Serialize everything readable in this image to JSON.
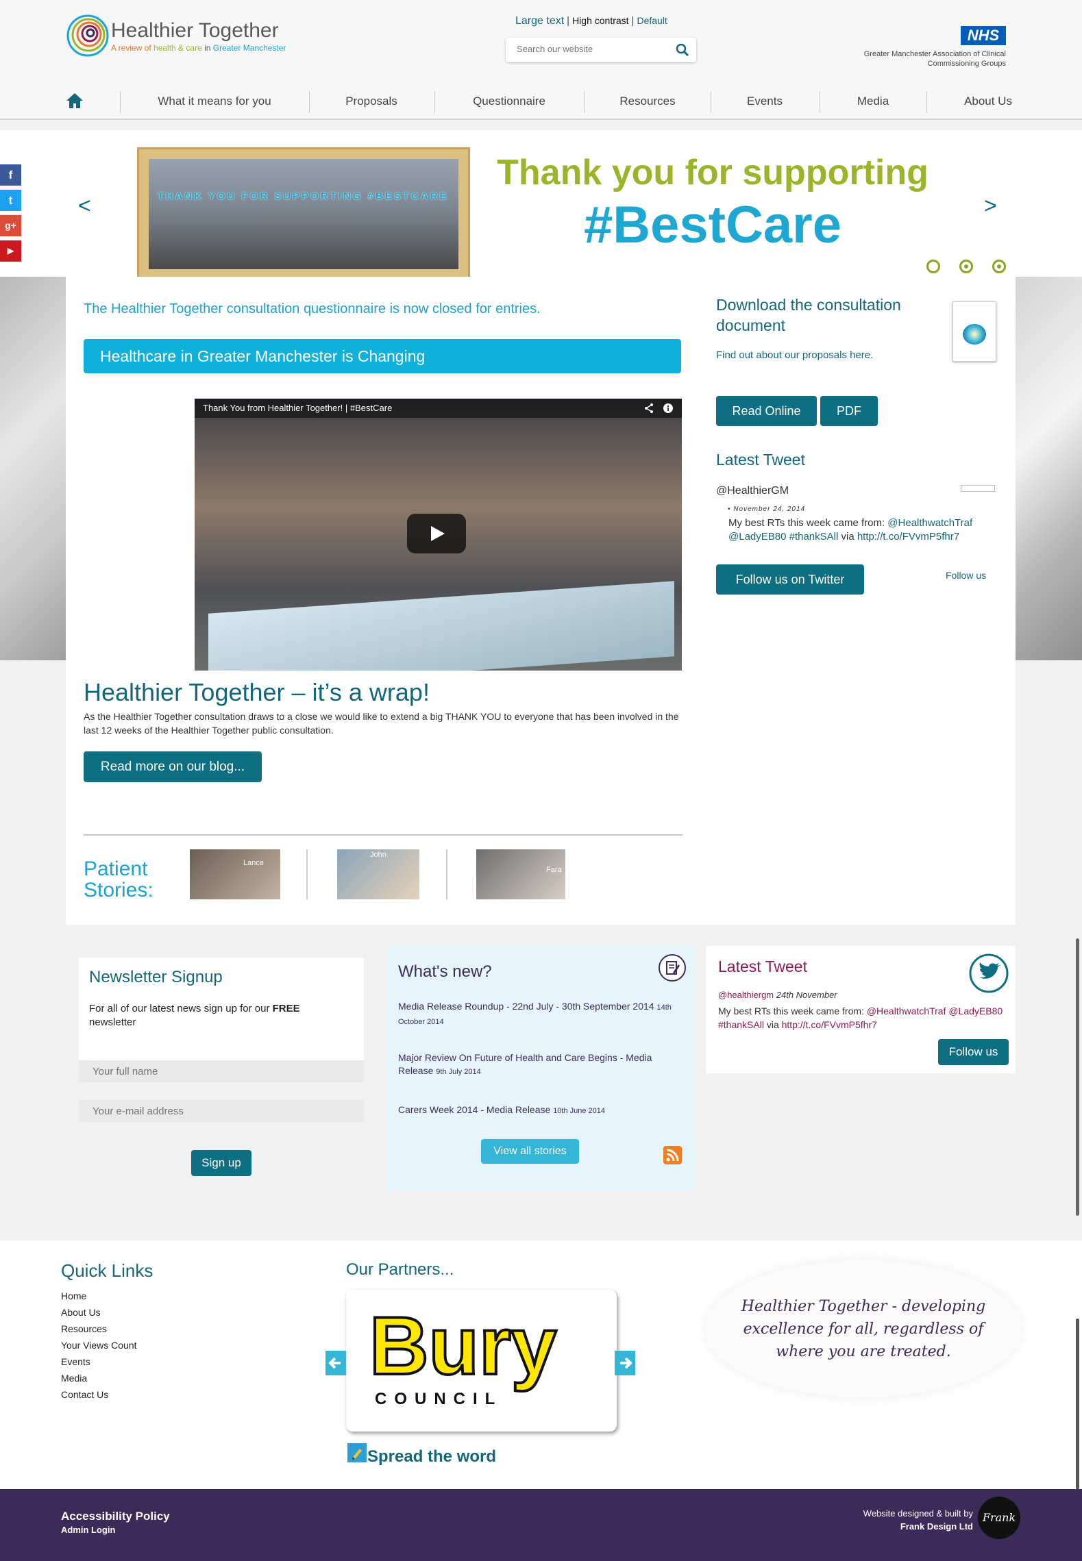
{
  "header": {
    "logo_title": "Healthier Together",
    "logo_sub_parts": [
      "A review of ",
      "health & care",
      " in ",
      "Greater Manchester"
    ],
    "access": {
      "large": "Large text",
      "high": "High contrast",
      "default": "Default",
      "sep": "|"
    },
    "search_placeholder": "Search our website",
    "nhs": "NHS",
    "nhs_text": "Greater Manchester Association of Clinical Commissioning Groups"
  },
  "nav": [
    "What it means for you",
    "Proposals",
    "Questionnaire",
    "Resources",
    "Events",
    "Media",
    "About Us"
  ],
  "social": [
    "f",
    "t",
    "g+",
    "▶"
  ],
  "hero": {
    "line1": "Thank you for supporting",
    "line2": "#BestCare",
    "prev": "<",
    "next": ">",
    "photo_letters": "THANK YOU FOR SUPPORTING #BESTCARE"
  },
  "main": {
    "closed_note": "The Healthier Together consultation questionnaire is now closed for entries.",
    "banner": "Healthcare in Greater Manchester is Changing",
    "video_title": "Thank You from Healthier Together! | #BestCare",
    "wrap_title": "Healthier Together – it’s a wrap!",
    "wrap_text": "As the Healthier Together consultation draws to a close we would like to extend a big THANK YOU to everyone that has been involved in the last 12 weeks of the Healthier Together public consultation.",
    "read_more": "Read more on our blog...",
    "stories_title": "Patient Stories:",
    "stories": [
      "Lance",
      "John",
      "Fara"
    ]
  },
  "sidebar": {
    "dl_title": "Download the consultation document",
    "dl_sub": "Find out about our proposals here.",
    "read_online": "Read Online",
    "pdf": "PDF",
    "latest_tweet": "Latest Tweet",
    "handle": "@HealthierGM",
    "date": "November 24, 2014",
    "tweet_pre": "My best RTs this week came from: ",
    "tweet_link1": "@HealthwatchTraf @LadyEB80 #thankSAll",
    "tweet_via": " via ",
    "tweet_link2": "http://t.co/FVvmP5fhr7",
    "follow_twitter": "Follow us on Twitter",
    "follow_us": "Follow us"
  },
  "newsletter": {
    "title": "Newsletter Signup",
    "text_pre": "For all of our latest news sign up for our ",
    "text_bold": "FREE",
    "text_post": " newsletter",
    "name_placeholder": "Your full name",
    "email_placeholder": "Your e-mail address",
    "signup": "Sign up"
  },
  "whats_new": {
    "title": "What's new?",
    "items": [
      {
        "title": "Media Release Roundup - 22nd July - 30th September 2014",
        "date": "14th October 2014"
      },
      {
        "title": "Major Review On Future of Health and Care Begins - Media Release",
        "date": "9th July 2014"
      },
      {
        "title": "Carers Week 2014 - Media Release",
        "date": "10th June 2014"
      }
    ],
    "view_all": "View all stories"
  },
  "latest_tweet2": {
    "title": "Latest Tweet",
    "handle": "@healthiergm",
    "date": "24th November",
    "tweet_pre": "My best RTs this week came from: ",
    "tweet_link1": "@HealthwatchTraf @LadyEB80 #thankSAll",
    "tweet_via": " via ",
    "tweet_link2": "http://t.co/FVvmP5fhr7",
    "follow": "Follow us"
  },
  "footer": {
    "ql_title": "Quick Links",
    "quick_links": [
      "Home",
      "About Us",
      "Resources",
      "Your Views Count",
      "Events",
      "Media",
      "Contact Us"
    ],
    "partners_title": "Our Partners...",
    "partner_word": "Bury",
    "partner_sub": "COUNCIL",
    "spread": "Spread the word",
    "tagline": "Healthier Together - developing excellence for all, regardless of where you are treated.",
    "accessibility": "Accessibility Policy",
    "admin": "Admin Login",
    "designed_line1": "Website designed & built by",
    "designed_line2": "Frank Design Ltd",
    "frank": "Frank"
  },
  "colors": {
    "teal": "#0e6f83",
    "cyan": "#1ba3d3",
    "green": "#9bb52a",
    "purple": "#3c2b58",
    "magenta": "#8e1a52"
  }
}
